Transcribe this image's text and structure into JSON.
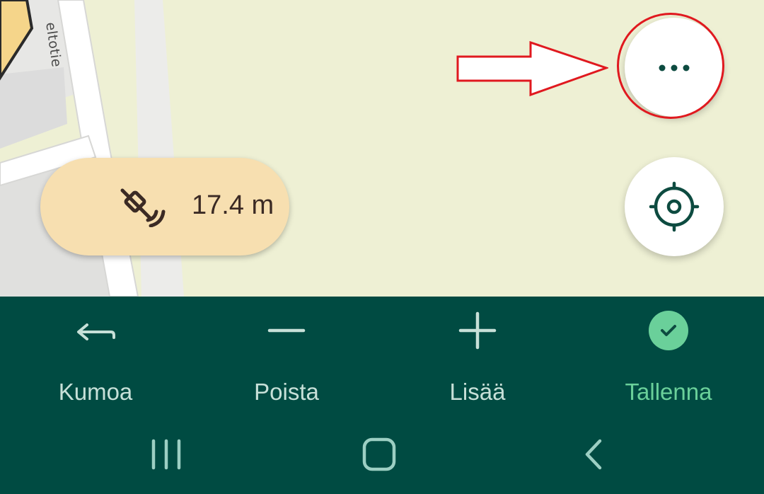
{
  "map": {
    "street_label": "eltotie"
  },
  "gps": {
    "accuracy": "17.4 m",
    "icon": "satellite-signal-icon"
  },
  "buttons": {
    "more_icon": "more-horizontal-icon",
    "locate_icon": "my-location-icon"
  },
  "toolbar": {
    "undo_label": "Kumoa",
    "remove_label": "Poista",
    "add_label": "Lisää",
    "save_label": "Tallenna"
  },
  "colors": {
    "toolbar_bg": "#004b42",
    "save_accent": "#6ad09a",
    "highlight": "#e0191f",
    "gps_pill": "#f7dfb0"
  },
  "system_nav": {
    "recents_icon": "recents-icon",
    "home_icon": "home-icon",
    "back_icon": "back-icon"
  }
}
